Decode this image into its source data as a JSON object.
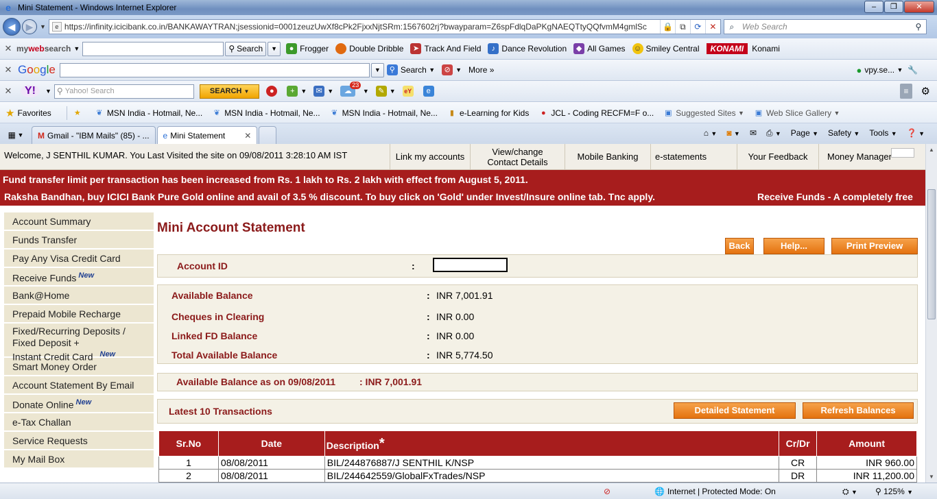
{
  "window": {
    "title": "Mini Statement - Windows Internet Explorer"
  },
  "address": {
    "url": "https://infinity.icicibank.co.in/BANKAWAYTRAN;jsessionid=0001zeuzUwXf8cPk2FjxxNjtSRm:1567602rj?bwayparam=Z6spFdlqDaPKgNAEQTtyQQfvmM4gmlSc",
    "search_placeholder": "Web Search"
  },
  "mywebsearch": {
    "brand_my": "my",
    "brand_web": "web",
    "brand_search": "search",
    "search_label": "Search",
    "links": [
      "Frogger",
      "Double Dribble",
      "Track And Field",
      "Dance Revolution",
      "All Games",
      "Smiley Central"
    ],
    "konami_logo": "KONAMI",
    "konami_label": "Konami"
  },
  "google": {
    "search_label": "Search",
    "more_label": "More",
    "account": "vpy.se..."
  },
  "yahoo": {
    "logo": "Y!",
    "search_placeholder": "Yahoo! Search",
    "search_button": "SEARCH",
    "mail_badge": "23"
  },
  "favorites": {
    "label": "Favorites",
    "items": [
      "MSN India - Hotmail, Ne...",
      "MSN India - Hotmail, Ne...",
      "MSN India - Hotmail, Ne...",
      "e-Learning for Kids",
      "JCL - Coding RECFM=F o...",
      "Suggested Sites",
      "Web Slice Gallery"
    ]
  },
  "tabs": [
    {
      "label": "Gmail - \"IBM Mails\" (85) - ..."
    },
    {
      "label": "Mini Statement"
    }
  ],
  "commandbar": {
    "page": "Page",
    "safety": "Safety",
    "tools": "Tools"
  },
  "bank": {
    "welcome": "Welcome, J SENTHIL KUMAR. You Last Visited the site on 09/08/2011 3:28:10 AM IST",
    "topnav": [
      "Link my accounts",
      "View/change\nContact Details",
      "Mobile Banking",
      "e-statements",
      "Your Feedback",
      "Money Manager"
    ],
    "ticker_1": "Fund transfer limit per transaction has been increased from Rs. 1 lakh to Rs. 2 lakh with effect from August 5, 2011.",
    "ticker_2": "Raksha Bandhan, buy ICICI Bank Pure Gold online and avail of 3.5 % discount. To buy click on 'Gold' under Invest/Insure online tab. Tnc apply.",
    "ticker_3": "Receive Funds - A completely free",
    "sidebar": {
      "account_summary": "Account Summary",
      "funds_transfer": "Funds Transfer",
      "visa_card": "Pay Any Visa Credit Card",
      "receive_funds": "Receive Funds",
      "bank_at_home": "Bank@Home",
      "prepaid": "Prepaid Mobile Recharge",
      "deposits": "Fixed/Recurring Deposits / Fixed Deposit +",
      "instant_credit": "Instant Credit Card",
      "smart_money": "Smart Money Order",
      "statement_email": "Account Statement By Email",
      "donate": "Donate Online",
      "etax": "e-Tax Challan",
      "service": "Service Requests",
      "mailbox": "My Mail Box",
      "new_badge": "New"
    },
    "page_title": "Mini Account Statement",
    "buttons": {
      "back": "Back",
      "help": "Help...",
      "print": "Print Preview",
      "detailed": "Detailed Statement",
      "refresh": "Refresh Balances"
    },
    "account_id_label": "Account ID",
    "colon": ":",
    "balances": {
      "available_label": "Available Balance",
      "available_value": "INR 7,001.91",
      "cheques_label": "Cheques in Clearing",
      "cheques_value": "INR 0.00",
      "linked_fd_label": "Linked FD Balance",
      "linked_fd_value": "INR 0.00",
      "total_label": "Total Available Balance",
      "total_value": "INR 5,774.50"
    },
    "asof_label": "Available Balance as on 09/08/2011",
    "asof_value": ": INR 7,001.91",
    "latest_label": "Latest 10 Transactions",
    "table": {
      "headers": [
        "Sr.No",
        "Date",
        "Description",
        "Cr/Dr",
        "Amount"
      ],
      "desc_star": "*",
      "rows": [
        [
          "1",
          "08/08/2011",
          "BIL/244876887/J SENTHIL K/NSP",
          "CR",
          "INR 960.00"
        ],
        [
          "2",
          "08/08/2011",
          "BIL/244642559/GlobalFxTrades/NSP",
          "DR",
          "INR 11,200.00"
        ]
      ]
    }
  },
  "status": {
    "zone": "Internet | Protected Mode: On",
    "zoom": "125%"
  }
}
